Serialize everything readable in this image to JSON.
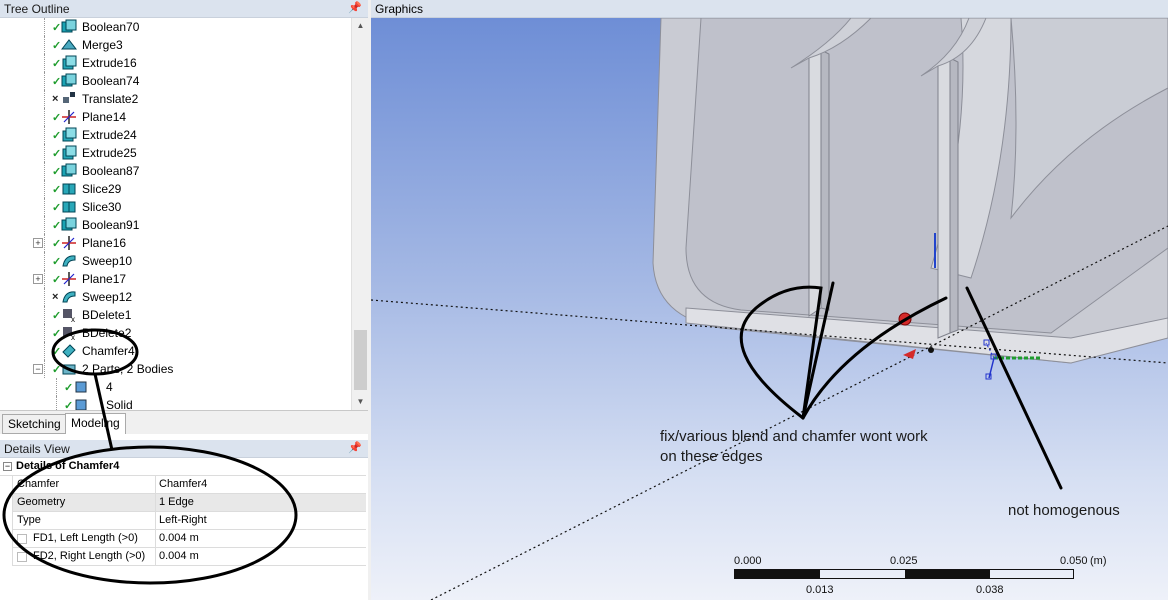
{
  "tree_outline": {
    "title": "Tree Outline",
    "items": [
      {
        "label": "Boolean70",
        "status": "ok",
        "icon": "boolean-icon"
      },
      {
        "label": "Merge3",
        "status": "ok",
        "icon": "merge-icon"
      },
      {
        "label": "Extrude16",
        "status": "ok",
        "icon": "extrude-icon"
      },
      {
        "label": "Boolean74",
        "status": "ok",
        "icon": "boolean-icon"
      },
      {
        "label": "Translate2",
        "status": "bad",
        "icon": "translate-icon"
      },
      {
        "label": "Plane14",
        "status": "ok",
        "icon": "plane-icon"
      },
      {
        "label": "Extrude24",
        "status": "ok",
        "icon": "extrude-icon"
      },
      {
        "label": "Extrude25",
        "status": "ok",
        "icon": "extrude-icon"
      },
      {
        "label": "Boolean87",
        "status": "ok",
        "icon": "boolean-icon"
      },
      {
        "label": "Slice29",
        "status": "ok",
        "icon": "slice-icon"
      },
      {
        "label": "Slice30",
        "status": "ok",
        "icon": "slice-icon"
      },
      {
        "label": "Boolean91",
        "status": "ok",
        "icon": "boolean-icon"
      },
      {
        "label": "Plane16",
        "status": "ok",
        "icon": "plane-icon",
        "expander": "+"
      },
      {
        "label": "Sweep10",
        "status": "ok",
        "icon": "sweep-icon"
      },
      {
        "label": "Plane17",
        "status": "ok",
        "icon": "plane-icon",
        "expander": "+"
      },
      {
        "label": "Sweep12",
        "status": "bad",
        "icon": "sweep-icon"
      },
      {
        "label": "BDelete1",
        "status": "ok",
        "icon": "body-delete-icon"
      },
      {
        "label": "BDelete2",
        "status": "ok",
        "icon": "body-delete-icon"
      },
      {
        "label": "Chamfer4",
        "status": "ok",
        "icon": "chamfer-icon"
      },
      {
        "label": "2 Parts, 2 Bodies",
        "status": "ok",
        "icon": "parts-icon",
        "expander": "−"
      },
      {
        "label": "4",
        "status": "ok",
        "icon": "body-icon",
        "indent": true
      },
      {
        "label": "Solid",
        "status": "ok",
        "icon": "body-icon",
        "indent": true
      }
    ]
  },
  "tabs": [
    {
      "label": "Sketching",
      "active": false
    },
    {
      "label": "Modeling",
      "active": true
    }
  ],
  "details_view": {
    "title": "Details View",
    "group": "Details of Chamfer4",
    "rows": [
      {
        "key": "Chamfer",
        "value": "Chamfer4"
      },
      {
        "key": "Geometry",
        "value": "1 Edge",
        "highlight": true
      },
      {
        "key": "Type",
        "value": "Left-Right"
      },
      {
        "key": "FD1,  Left Length (>0)",
        "value": "0.004 m",
        "checkbox": true
      },
      {
        "key": "FD2,  Right Length (>0)",
        "value": "0.004 m",
        "checkbox": true
      }
    ]
  },
  "graphics": {
    "title": "Graphics",
    "annotations": {
      "blend_note_line1": "fix/various blend and chamfer wont work",
      "blend_note_line2": "on these edges",
      "homogenous_note": "not homogenous"
    },
    "scale": {
      "top_labels": [
        "0.000",
        "0.025",
        "0.050"
      ],
      "unit": "(m)",
      "bottom_labels": [
        "0.013",
        "0.038"
      ]
    }
  },
  "colors": {
    "header_bg": "#dbe3ee",
    "ok_check": "#1e9c2d",
    "viewport_top": "#6e8ed6",
    "viewport_bottom": "#eef1f9"
  }
}
